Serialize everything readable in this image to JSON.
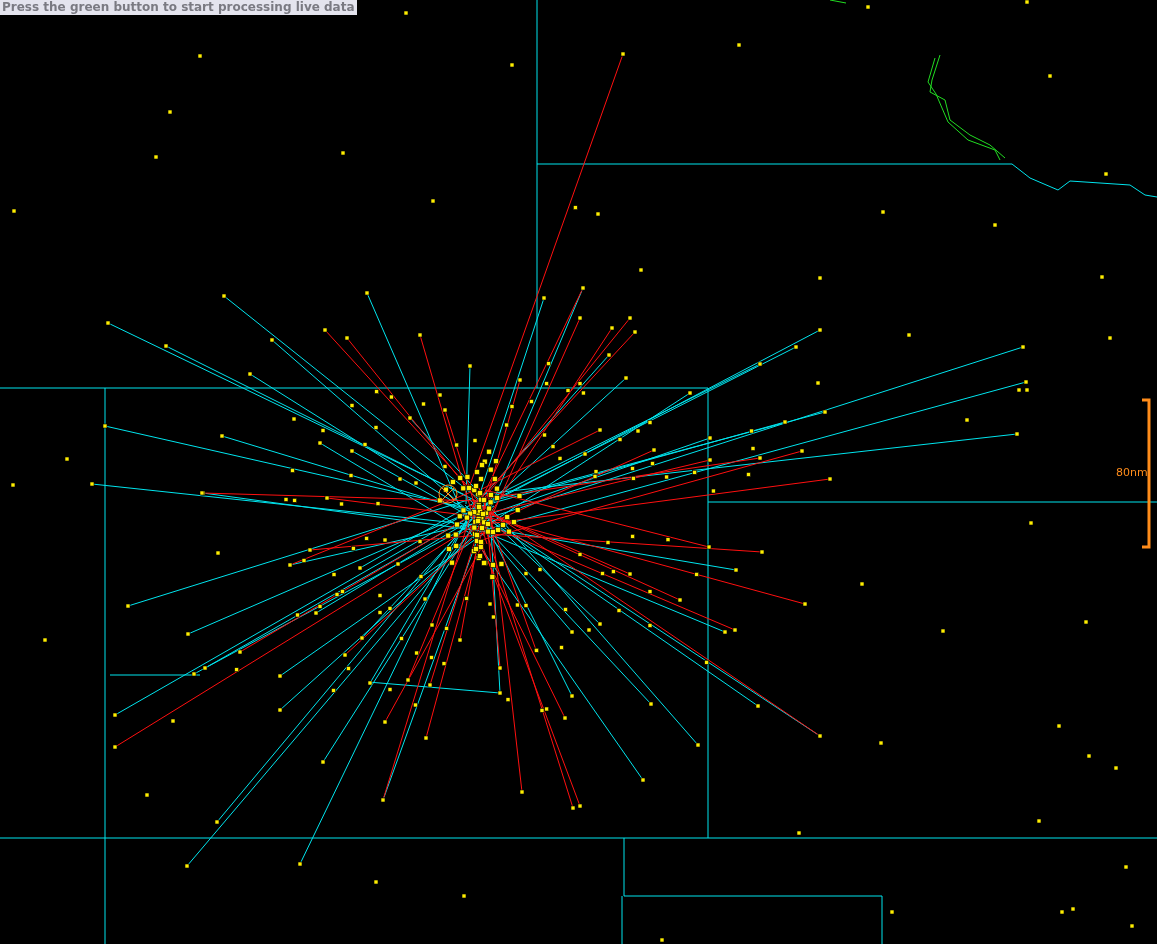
{
  "banner": {
    "text": "Press the green button to start processing live data"
  },
  "scale": {
    "label": "80nm"
  }
}
